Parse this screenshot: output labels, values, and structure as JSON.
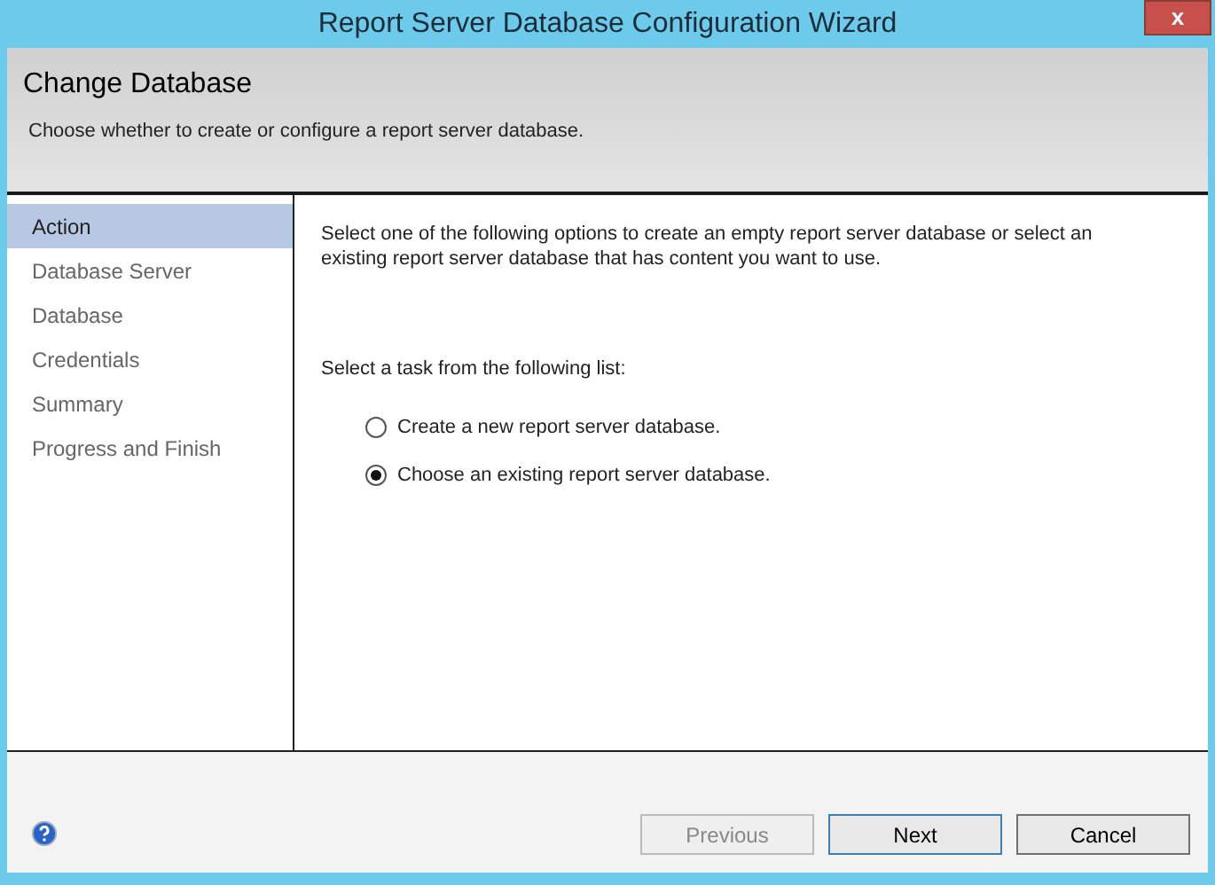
{
  "window": {
    "title": "Report Server Database Configuration Wizard",
    "close": "x"
  },
  "header": {
    "title": "Change Database",
    "subtitle": "Choose whether to create or configure a report server database."
  },
  "sidebar": {
    "items": [
      {
        "label": "Action",
        "selected": true
      },
      {
        "label": "Database Server",
        "selected": false
      },
      {
        "label": "Database",
        "selected": false
      },
      {
        "label": "Credentials",
        "selected": false
      },
      {
        "label": "Summary",
        "selected": false
      },
      {
        "label": "Progress and Finish",
        "selected": false
      }
    ]
  },
  "content": {
    "intro": "Select one of the following options to create an empty report server database or select an existing report server database that has content you want to use.",
    "prompt": "Select a task from the following list:",
    "options": [
      {
        "label": "Create a new report server database.",
        "selected": false
      },
      {
        "label": "Choose an existing report server database.",
        "selected": true
      }
    ]
  },
  "buttons": [
    {
      "label": "Previous",
      "disabled": true,
      "default": false
    },
    {
      "label": "Next",
      "disabled": false,
      "default": true
    },
    {
      "label": "Cancel",
      "disabled": false,
      "default": false
    }
  ]
}
